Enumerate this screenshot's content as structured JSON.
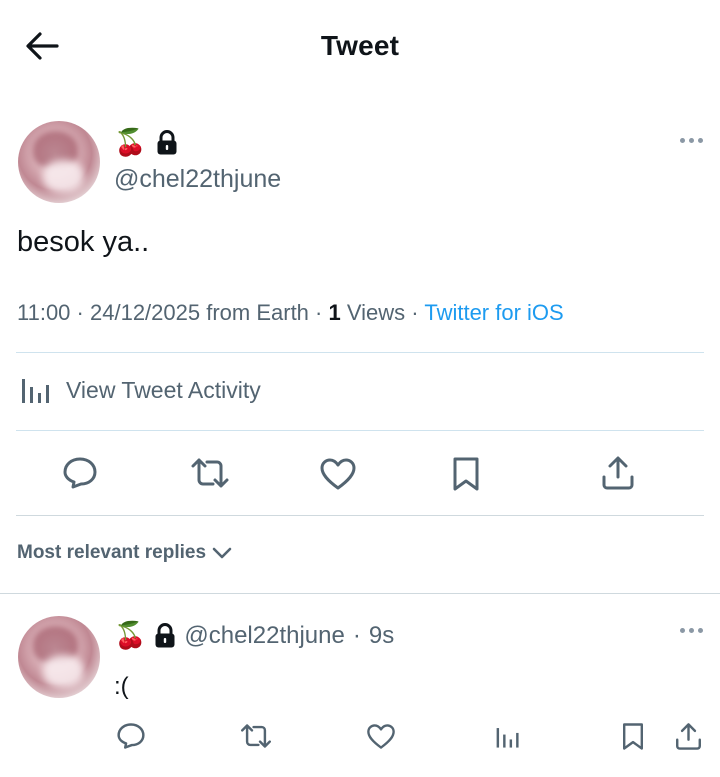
{
  "header": {
    "title": "Tweet"
  },
  "tweet": {
    "author": {
      "name_emoji": "🍒",
      "handle": "@chel22thjune"
    },
    "text": "besok ya..",
    "meta": {
      "time": "11:00",
      "date": "24/12/2025 from Earth",
      "views_count": "1",
      "views_label": "Views",
      "source": "Twitter for iOS"
    },
    "activity_label": "View Tweet Activity"
  },
  "replies": {
    "sort_label": "Most relevant replies",
    "items": [
      {
        "name_emoji": "🍒",
        "handle": "@chel22thjune",
        "age": "9s",
        "text": ":("
      }
    ]
  },
  "icons": [
    "back-arrow-icon",
    "cherry-emoji",
    "lock-icon",
    "more-icon",
    "bar-chart-icon",
    "reply-icon",
    "retweet-icon",
    "like-icon",
    "bookmark-icon",
    "share-icon",
    "chevron-down-icon"
  ],
  "colors": {
    "accent": "#1d9bf0",
    "text": "#0f1419",
    "muted": "#536471",
    "divider": "#cfd9de"
  }
}
